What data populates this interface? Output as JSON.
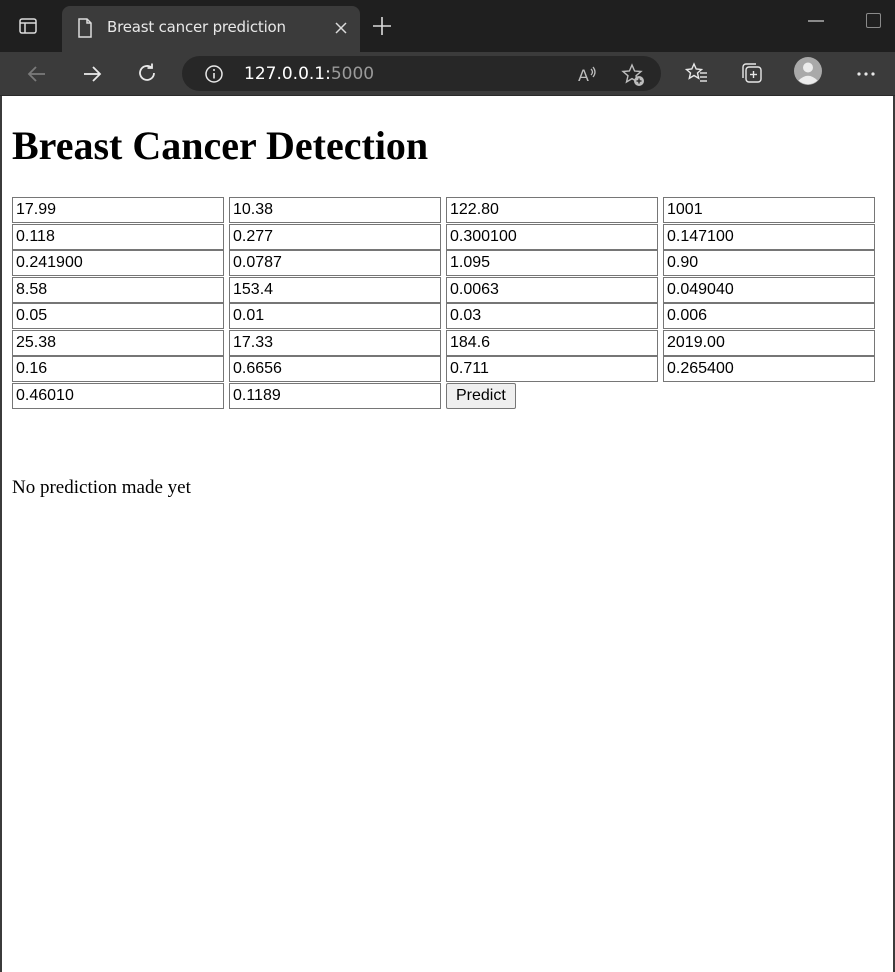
{
  "browser": {
    "tab_title": "Breast cancer prediction",
    "url_host": "127.0.0.1:",
    "url_port": "5000"
  },
  "page": {
    "heading": "Breast Cancer Detection",
    "inputs": [
      "17.99",
      "10.38",
      "122.80",
      "1001",
      "0.118",
      "0.277",
      "0.300100",
      "0.147100",
      "0.241900",
      "0.0787",
      "1.095",
      "0.90",
      "8.58",
      "153.4",
      "0.0063",
      "0.049040",
      "0.05",
      "0.01",
      "0.03",
      "0.006",
      "25.38",
      "17.33",
      "184.6",
      "2019.00",
      "0.16",
      "0.6656",
      "0.711",
      "0.265400",
      "0.46010",
      "0.1189"
    ],
    "predict_label": "Predict",
    "result_text": "No prediction made yet"
  }
}
